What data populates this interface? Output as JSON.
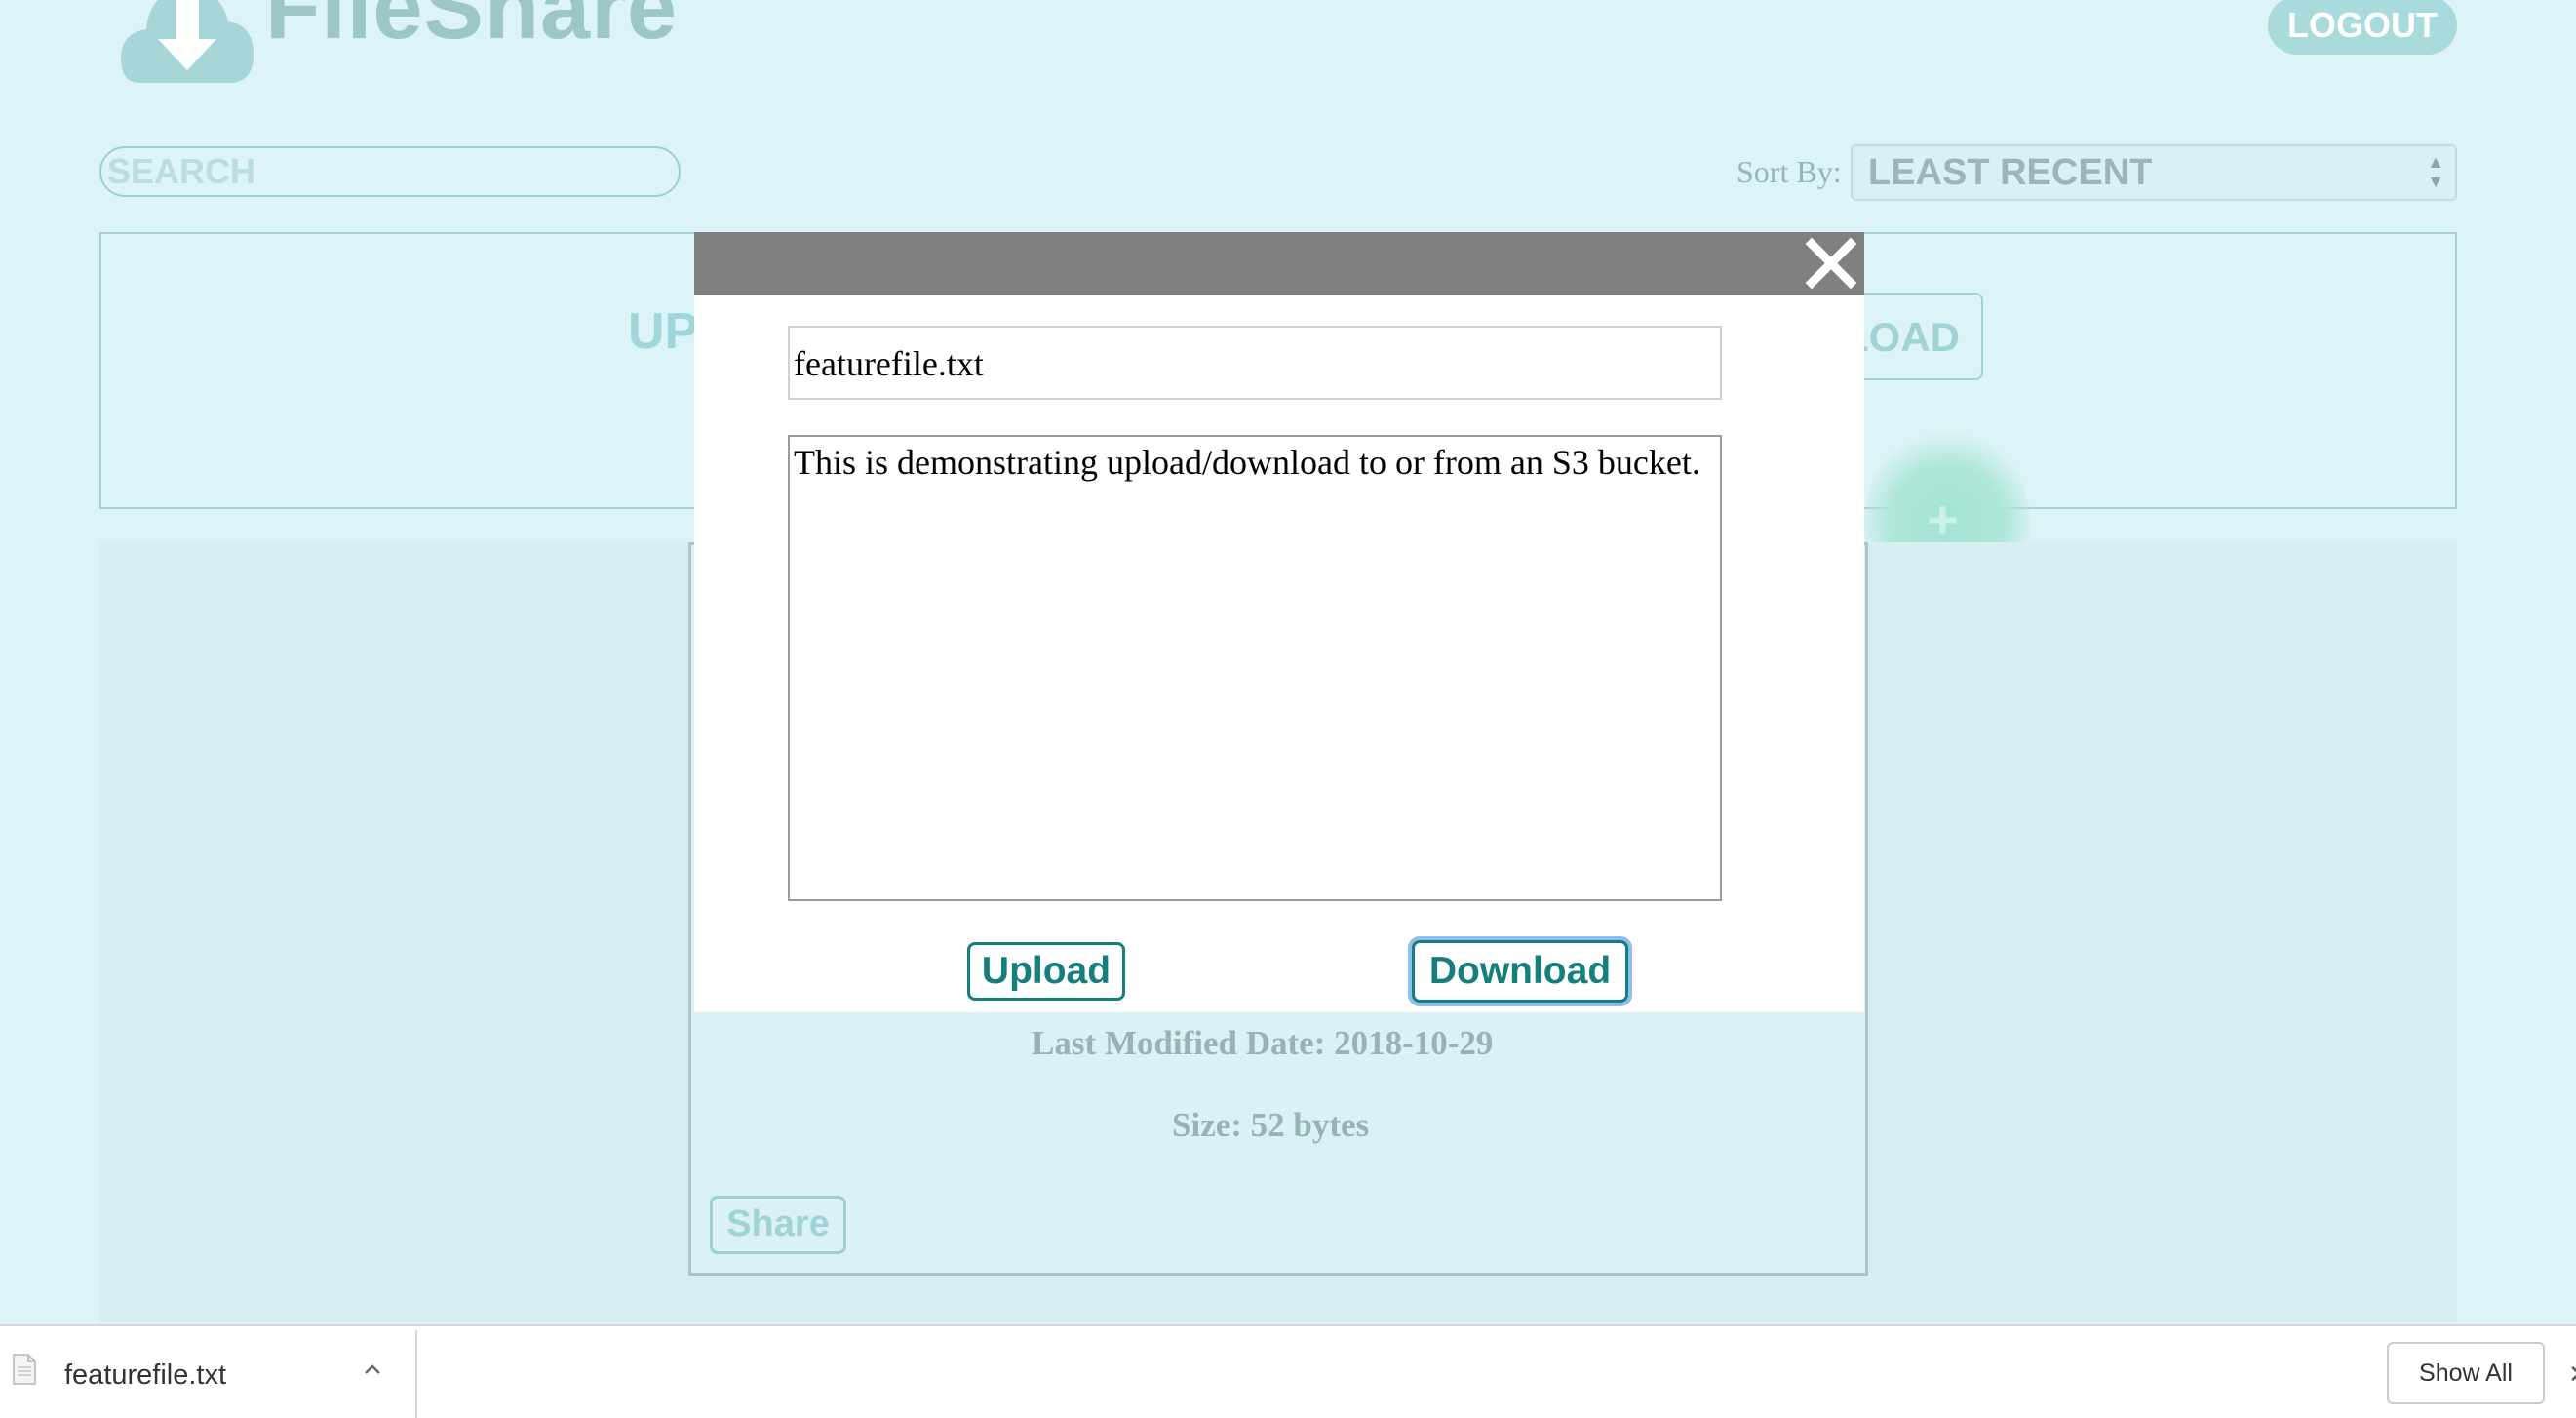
{
  "header": {
    "logo_text": "FileShare",
    "logout_label": "LOGOUT"
  },
  "toolbar": {
    "search_placeholder": "SEARCH",
    "sort_label": "Sort By:",
    "sort_value": "LEAST RECENT"
  },
  "upload_panel": {
    "upload_tab_visible": "UP",
    "download_tab_visible": "LOAD",
    "fab_icon": "plus-icon"
  },
  "file_card": {
    "last_modified": "Last Modified Date: 2018-10-29",
    "size": "Size: 52 bytes",
    "share_label": "Share"
  },
  "modal": {
    "filename": "featurefile.txt",
    "content": "This is demonstrating upload/download to or from an S3 bucket.",
    "upload_label": "Upload",
    "download_label": "Download",
    "close_icon": "close-icon"
  },
  "download_bar": {
    "filename": "featurefile.txt",
    "show_all_label": "Show All"
  },
  "colors": {
    "background": "#dcf3f7",
    "accent": "#157f7b",
    "modal_bar": "#808080"
  }
}
